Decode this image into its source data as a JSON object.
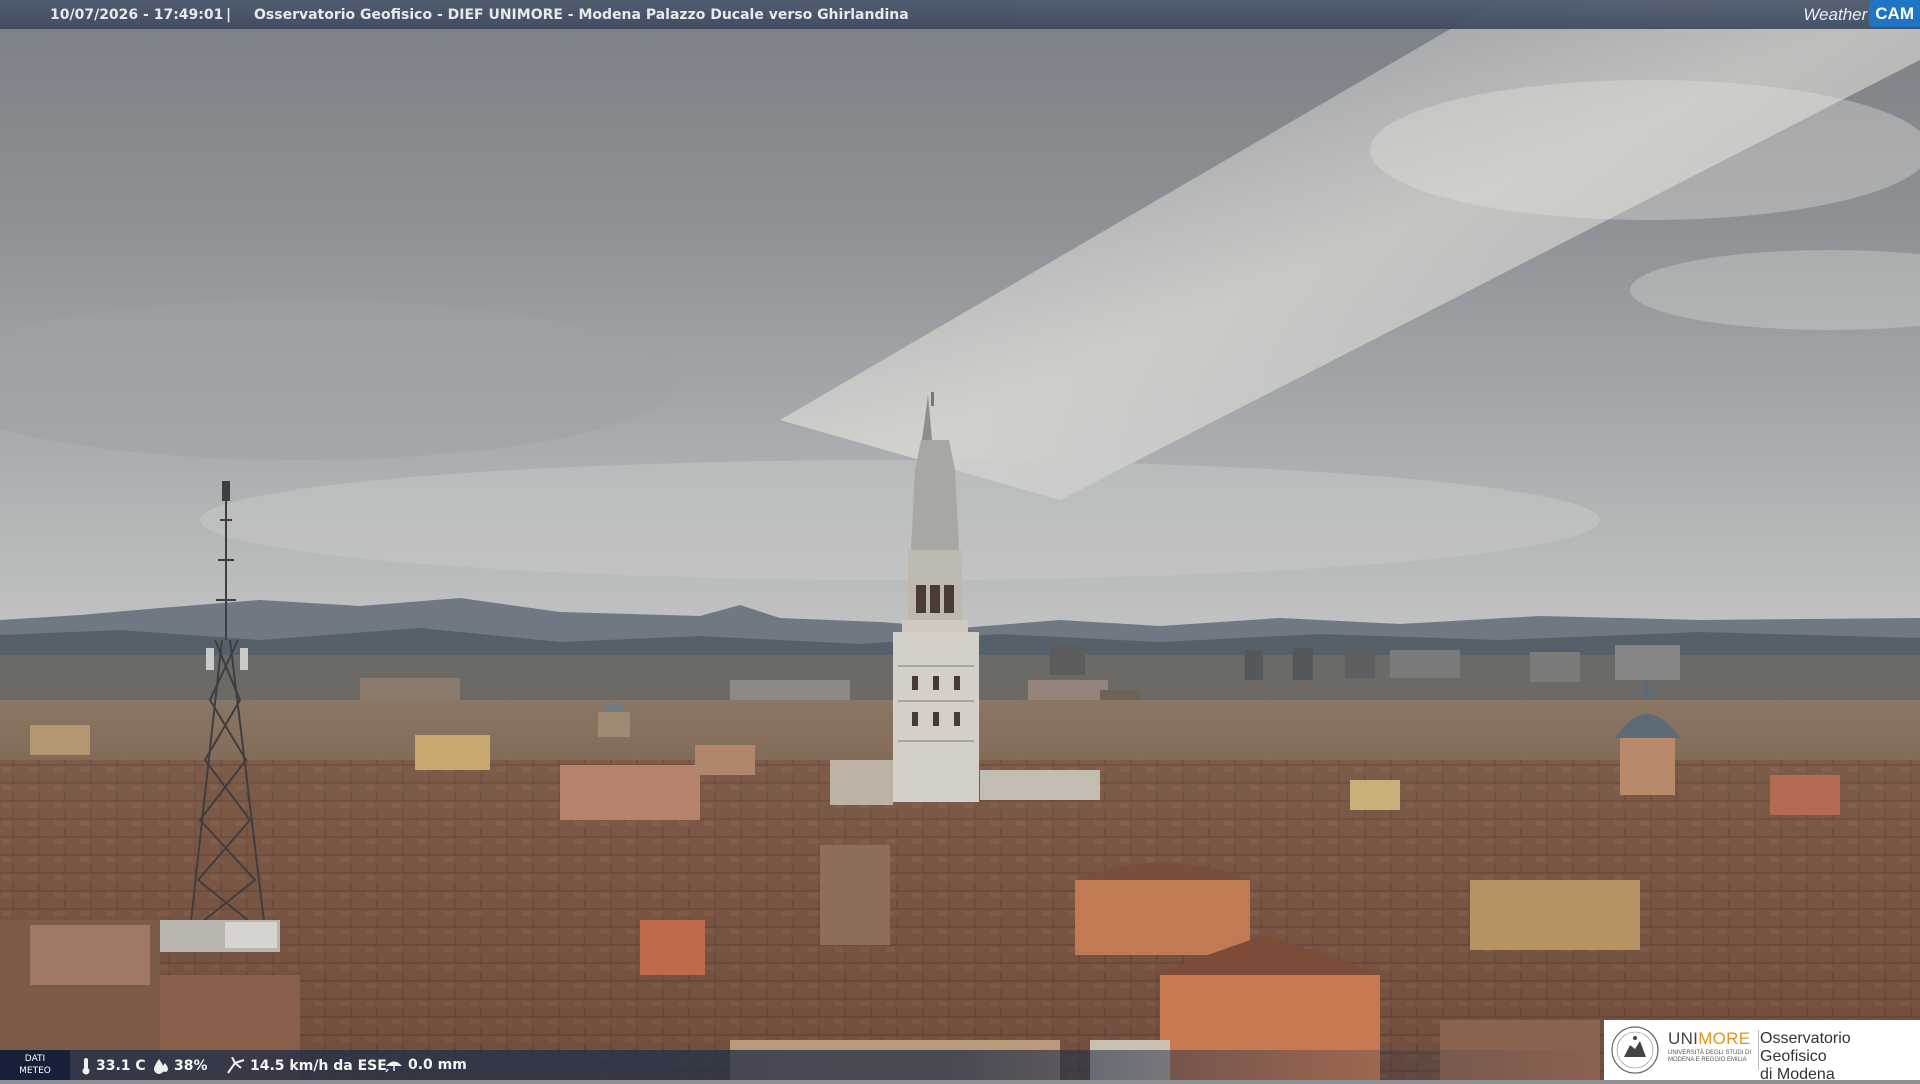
{
  "header": {
    "timestamp": "10/07/2026 - 17:49:01",
    "separator": "|",
    "title": "Osservatorio Geofisico - DIEF UNIMORE - Modena Palazzo Ducale verso Ghirlandina",
    "brand_weather": "Weather",
    "brand_cam": "CAM"
  },
  "weather": {
    "label_line1": "DATI",
    "label_line2": "METEO",
    "temperature": "33.1 C",
    "humidity": "38%",
    "wind": "14.5 km/h da ESE",
    "rain": "0.0 mm",
    "icons": [
      "thermometer-icon",
      "humidity-drop-icon",
      "wind-icon",
      "rain-icon"
    ]
  },
  "logo": {
    "uni_part1": "UNI",
    "uni_part2": "MORE",
    "subtitle": "UNIVERSITÀ DEGLI STUDI DI MODENA E REGGIO EMILIA",
    "observatory_line1": "Osservatorio Geofisico",
    "observatory_line2": "di Modena"
  },
  "colors": {
    "bar": "#3f4b62",
    "cam_badge": "#1f74c4",
    "unimore_orange": "#e6911f"
  }
}
